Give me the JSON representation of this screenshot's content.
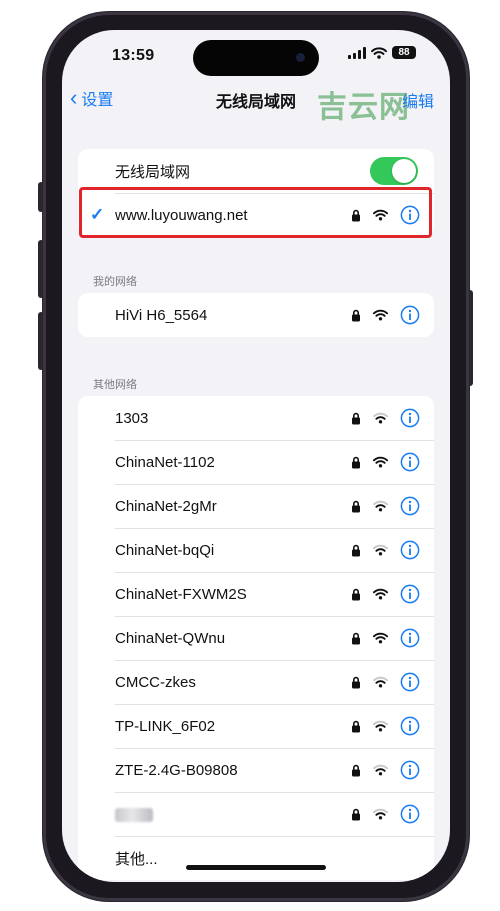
{
  "status_bar": {
    "time": "13:59",
    "battery": "88"
  },
  "nav": {
    "back_label": "设置",
    "title": "无线局域网",
    "edit_label": "编辑",
    "watermark": "吉云网"
  },
  "wifi_toggle": {
    "label": "无线局域网",
    "on": true
  },
  "connected": {
    "ssid": "www.luyouwang.net"
  },
  "my_networks": {
    "header": "我的网络",
    "items": [
      {
        "ssid": "HiVi H6_5564"
      }
    ]
  },
  "other_networks": {
    "header": "其他网络",
    "items": [
      {
        "ssid": "1303"
      },
      {
        "ssid": "ChinaNet-1102"
      },
      {
        "ssid": "ChinaNet-2gMr"
      },
      {
        "ssid": "ChinaNet-bqQi"
      },
      {
        "ssid": "ChinaNet-FXWM2S"
      },
      {
        "ssid": "ChinaNet-QWnu"
      },
      {
        "ssid": "CMCC-zkes"
      },
      {
        "ssid": "TP-LINK_6F02"
      },
      {
        "ssid": "ZTE-2.4G-B09808"
      },
      {
        "ssid": ""
      }
    ],
    "other_label": "其他..."
  },
  "colors": {
    "accent": "#1a7cf0",
    "toggle_on": "#34c759",
    "highlight_border": "#e0262b",
    "watermark": "#78b882"
  }
}
